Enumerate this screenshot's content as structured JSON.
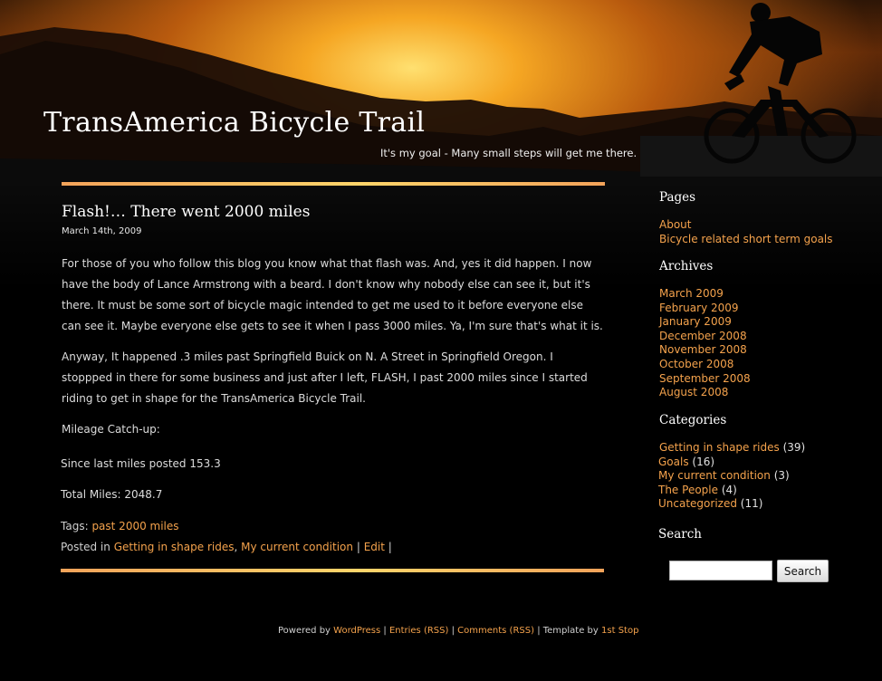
{
  "header": {
    "title": "TransAmerica Bicycle Trail",
    "tagline": "It's my goal - Many small steps will get me there."
  },
  "post": {
    "title": "Flash!… There went 2000 miles",
    "date": "March 14th, 2009",
    "paragraphs": [
      "For those of you who follow this blog you know what that flash was. And, yes it did happen. I now have the body of Lance Armstrong with a beard. I don't know why nobody else can see it, but it's there. It must be some sort of bicycle magic intended to get me used to it before everyone else can see it. Maybe everyone else gets to see it when I pass 3000 miles. Ya, I'm sure that's what it is.",
      "Anyway, It happened .3 miles past Springfield Buick on N. A Street in Springfield Oregon. I stoppped in there for some business and just after I left, FLASH, I past 2000 miles since I started riding to get in shape for the TransAmerica Bicycle Trail.",
      "Mileage Catch-up:",
      "Since last miles posted 153.3",
      "Total Miles: 2048.7"
    ],
    "tags_label": "Tags:",
    "tag": "past 2000 miles",
    "posted_in_label": "Posted in",
    "category_1": "Getting in shape rides",
    "comma": ",",
    "category_2": "My current condition",
    "separator": "|",
    "edit_label": "Edit",
    "trailing_separator": "|"
  },
  "sidebar": {
    "pages_heading": "Pages",
    "pages": [
      "About",
      "Bicycle related short term goals"
    ],
    "archives_heading": "Archives",
    "archives": [
      "March 2009",
      "February 2009",
      "January 2009",
      "December 2008",
      "November 2008",
      "October 2008",
      "September 2008",
      "August 2008"
    ],
    "categories_heading": "Categories",
    "categories": [
      {
        "name": "Getting in shape rides",
        "count": "(39)"
      },
      {
        "name": "Goals",
        "count": "(16)"
      },
      {
        "name": "My current condition",
        "count": "(3)"
      },
      {
        "name": "The People",
        "count": "(4)"
      },
      {
        "name": "Uncategorized",
        "count": "(11)"
      }
    ],
    "search_heading": "Search",
    "search_value": "",
    "search_button": "Search"
  },
  "footer": {
    "powered_by": "Powered by",
    "wordpress": "WordPress",
    "sep1": "|",
    "entries_rss": "Entries (RSS)",
    "sep2": "|",
    "comments_rss": "Comments (RSS)",
    "sep3": "|",
    "template_by": "Template by",
    "first_stop": "1st Stop"
  },
  "colors": {
    "link": "#f4a24c",
    "background": "#000000",
    "rule": "#ffd56a"
  }
}
